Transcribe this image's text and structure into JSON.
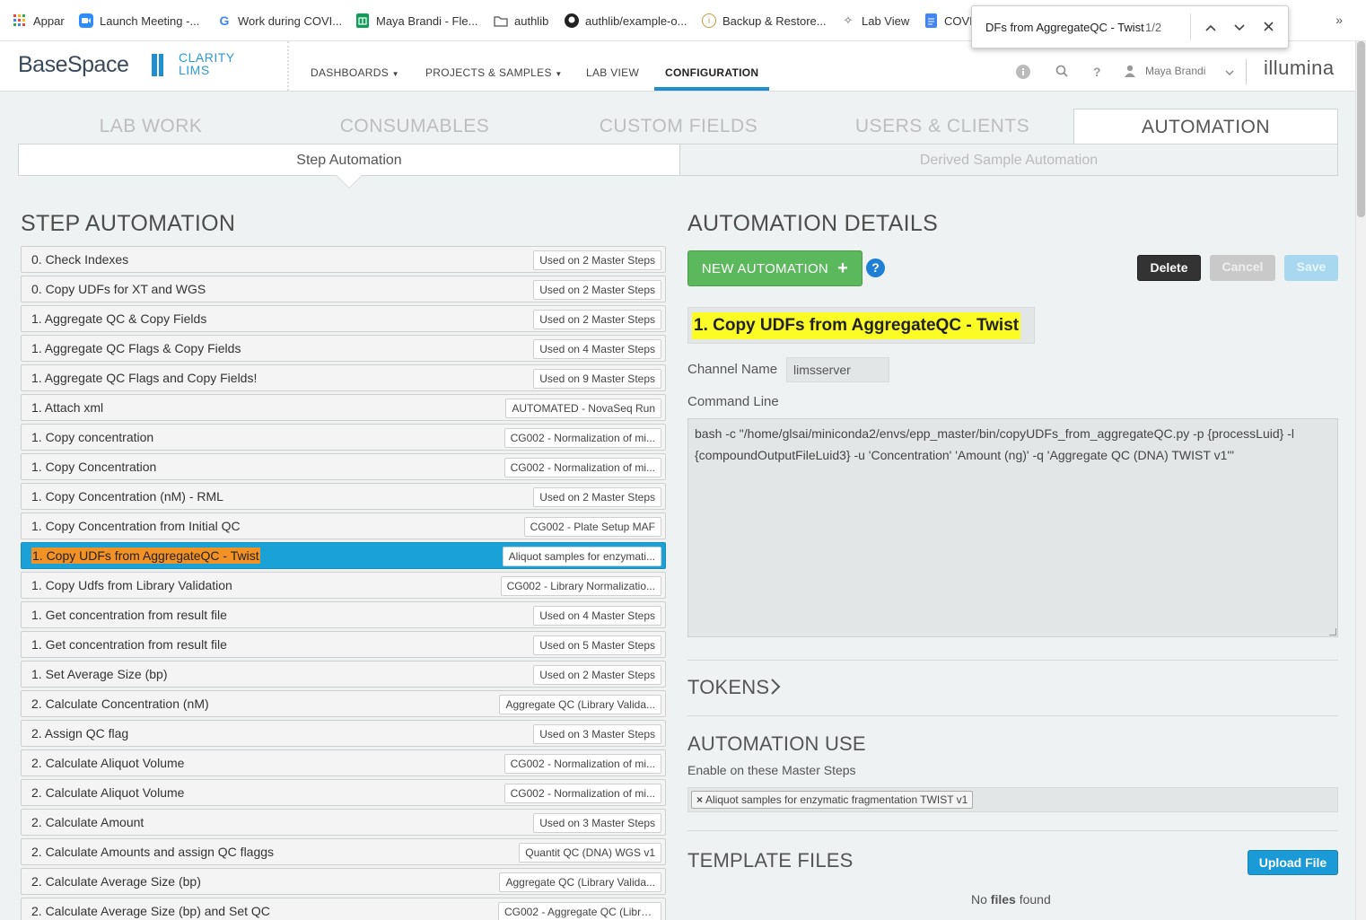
{
  "bookmarks": [
    {
      "label": "Appar",
      "icon": "apps-grid-icon"
    },
    {
      "label": "Launch Meeting -...",
      "icon": "zoom-icon"
    },
    {
      "label": "Work during COVI...",
      "icon": "google-icon"
    },
    {
      "label": "Maya Brandi - Fle...",
      "icon": "sheets-icon"
    },
    {
      "label": "authlib",
      "icon": "folder-icon"
    },
    {
      "label": "authlib/example-o...",
      "icon": "github-icon"
    },
    {
      "label": "Backup & Restore...",
      "icon": "info-icon"
    },
    {
      "label": "Lab View",
      "icon": "lab-icon"
    },
    {
      "label": "COVI",
      "icon": "docs-icon"
    }
  ],
  "bookmarks_more": "»",
  "findbar": {
    "query": "DFs from AggregateQC - Twist",
    "count": "1/2"
  },
  "header": {
    "logo_basespace": "BaseSpace",
    "logo_clarity_1": "CLARITY",
    "logo_clarity_2": "LIMS",
    "nav": [
      "DASHBOARDS",
      "PROJECTS & SAMPLES",
      "LAB VIEW",
      "CONFIGURATION"
    ],
    "user": "Maya Brandi",
    "brand": "illumina"
  },
  "tabs": [
    "LAB WORK",
    "CONSUMABLES",
    "CUSTOM FIELDS",
    "USERS & CLIENTS",
    "AUTOMATION"
  ],
  "subtabs": [
    "Step Automation",
    "Derived Sample Automation"
  ],
  "left": {
    "title": "STEP AUTOMATION",
    "rows": [
      {
        "name": "0. Check Indexes",
        "tag": "Used on 2 Master Steps"
      },
      {
        "name": "0. Copy UDFs for XT and WGS",
        "tag": "Used on 2 Master Steps"
      },
      {
        "name": "1. Aggregate QC & Copy Fields",
        "tag": "Used on 2 Master Steps"
      },
      {
        "name": "1. Aggregate QC Flags & Copy Fields",
        "tag": "Used on 4 Master Steps"
      },
      {
        "name": "1. Aggregate QC Flags and Copy Fields!",
        "tag": "Used on 9 Master Steps"
      },
      {
        "name": "1. Attach xml",
        "tag": "AUTOMATED - NovaSeq Run"
      },
      {
        "name": "1. Copy concentration",
        "tag": "CG002 - Normalization of mi..."
      },
      {
        "name": "1. Copy Concentration",
        "tag": "CG002 - Normalization of mi..."
      },
      {
        "name": "1. Copy Concentration (nM) - RML",
        "tag": "Used on 2 Master Steps"
      },
      {
        "name": "1. Copy Concentration from Initial QC",
        "tag": "CG002 - Plate Setup MAF"
      },
      {
        "name": "1. Copy UDFs from AggregateQC - Twist",
        "tag": "Aliquot samples for enzymati..."
      },
      {
        "name": "1. Copy Udfs from Library Validation",
        "tag": "CG002 - Library Normalizatio..."
      },
      {
        "name": "1. Get concentration from result file",
        "tag": "Used on 4 Master Steps"
      },
      {
        "name": "1. Get concentration from result file",
        "tag": "Used on 5 Master Steps"
      },
      {
        "name": "1. Set Average Size (bp)",
        "tag": "Used on 2 Master Steps"
      },
      {
        "name": "2. Calculate Concentration (nM)",
        "tag": "Aggregate QC (Library Valida..."
      },
      {
        "name": "2. Assign QC flag",
        "tag": "Used on 3 Master Steps"
      },
      {
        "name": "2. Calculate Aliquot Volume",
        "tag": "CG002 - Normalization of mi..."
      },
      {
        "name": "2. Calculate Aliquot Volume",
        "tag": "CG002 - Normalization of mi..."
      },
      {
        "name": "2. Calculate Amount",
        "tag": "Used on 3 Master Steps"
      },
      {
        "name": "2. Calculate Amounts and assign QC flaggs",
        "tag": "Quantit QC (DNA) WGS v1"
      },
      {
        "name": "2. Calculate Average Size (bp)",
        "tag": "Aggregate QC (Library Valida..."
      },
      {
        "name": "2. Calculate Average Size (bp) and Set QC",
        "tag": "CG002 - Aggregate QC (Libra..."
      }
    ],
    "selected_index": 10
  },
  "right": {
    "title": "AUTOMATION DETAILS",
    "new_button": "NEW AUTOMATION",
    "new_button_plus": "+",
    "help": "?",
    "delete": "Delete",
    "cancel": "Cancel",
    "save": "Save",
    "automation_name": "1. Copy UDFs from AggregateQC - Twist",
    "channel_label": "Channel Name",
    "channel_value": "limsserver",
    "command_label": "Command Line",
    "command_value": "bash -c \"/home/glsai/miniconda2/envs/epp_master/bin/copyUDFs_from_aggregateQC.py -p {processLuid} -l {compoundOutputFileLuid3} -u 'Concentration' 'Amount (ng)' -q 'Aggregate QC (DNA) TWIST v1'\"",
    "tokens": "TOKENS",
    "tokens_chevron": "›",
    "automation_use": "AUTOMATION USE",
    "enable_label": "Enable on these Master Steps",
    "chip_x": "×",
    "master_step": "Aliquot samples for enzymatic fragmentation TWIST v1",
    "template_files": "TEMPLATE FILES",
    "upload": "Upload File",
    "no_files_1": "No ",
    "no_files_2": "files",
    "no_files_3": " found"
  },
  "colors": {
    "accent": "#1f8fd0",
    "selected_row": "#1aa1d6",
    "highlight": "#f39224",
    "find_highlight": "#fbfb25",
    "new_button": "#5cb85c"
  }
}
